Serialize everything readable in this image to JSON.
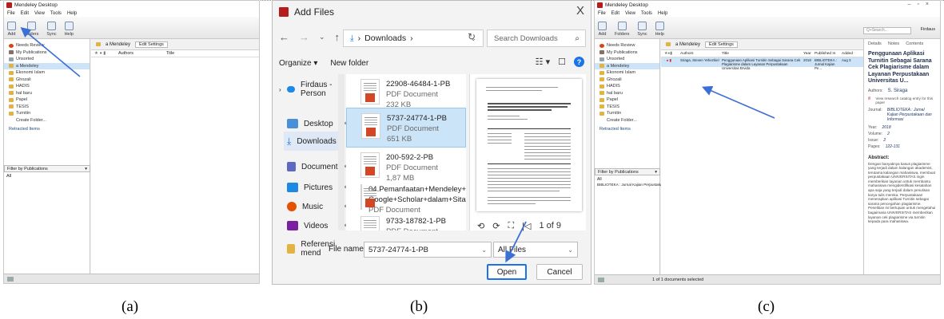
{
  "captions": [
    "(a)",
    "(b)",
    "(c)"
  ],
  "mendeley_a": {
    "title": "Mendeley Desktop",
    "menu": [
      "File",
      "Edit",
      "View",
      "Tools",
      "Help"
    ],
    "toolbar": [
      "Add",
      "Folders",
      "Sync",
      "Help"
    ],
    "sidebar": [
      "Needs Review",
      "My Publications",
      "Unsorted",
      "a Mendeley",
      "Ekonomi Islam",
      "Ghozali",
      "HADIS",
      "hal baru",
      "Papel",
      "TESIS",
      "Turnitin",
      "Create Folder..."
    ],
    "sidebar_section": "Retracted Items",
    "filter": "Filter by Publications",
    "filter_value": "All",
    "tab_title": "a Mendeley",
    "tab_edit": "Edit Settings",
    "columns": [
      "Authors",
      "Title"
    ]
  },
  "dialog": {
    "title": "Add Files",
    "close": "X",
    "path_label": "Downloads",
    "search_placeholder": "Search Downloads",
    "organize": "Organize",
    "new_folder": "New folder",
    "nav": [
      {
        "label": "Firdaus - Person",
        "color": "#1e88e5"
      },
      {
        "label": "Desktop",
        "color": "#4a90d9"
      },
      {
        "label": "Downloads",
        "color": "#2e7d32"
      },
      {
        "label": "Documents",
        "color": "#5c6bc0"
      },
      {
        "label": "Pictures",
        "color": "#1e88e5"
      },
      {
        "label": "Music",
        "color": "#e65100"
      },
      {
        "label": "Videos",
        "color": "#7b1fa2"
      },
      {
        "label": "Referensi mend",
        "color": "#e3b341"
      }
    ],
    "files": [
      {
        "name": "22908-46484-1-PB",
        "type": "PDF Document",
        "size": "232 KB"
      },
      {
        "name": "5737-24774-1-PB",
        "type": "PDF Document",
        "size": "651 KB"
      },
      {
        "name": "200-592-2-PB",
        "type": "PDF Document",
        "size": "1,87 MB"
      },
      {
        "name": "04.Pemanfaatan+Mendeley+dan+",
        "name2": "Google+Scholar+dalam+Sitasi",
        "type": "PDF Document"
      },
      {
        "name": "9733-18782-1-PB",
        "type": "PDF Document",
        "size": ""
      }
    ],
    "page_indicator": "1 of 9",
    "filename_label": "File name:",
    "filename_value": "5737-24774-1-PB",
    "filetype": "All Files",
    "open": "Open",
    "cancel": "Cancel"
  },
  "mendeley_c": {
    "title": "Mendeley Desktop",
    "menu": [
      "File",
      "Edit",
      "View",
      "Tools",
      "Help"
    ],
    "toolbar": [
      "Add",
      "Folders",
      "Sync",
      "Help"
    ],
    "user": "Firdaus",
    "search": "Q+Search...",
    "sidebar": [
      "Needs Review",
      "My Publications",
      "Unsorted",
      "a Mendeley",
      "Ekonomi Islam",
      "Ghozali",
      "HADIS",
      "hal baru",
      "Papel",
      "TESIS",
      "Turnitin",
      "Create Folder..."
    ],
    "sidebar_section": "Retracted Items",
    "filter": "Filter by Publications",
    "filter_value": "All",
    "filter_item": "BIBLIOTEKA : Jurnal Kajian Perpustakaan dan Inf",
    "tab_title": "a Mendeley",
    "tab_edit": "Edit Settings",
    "columns": [
      "Authors",
      "Title",
      "Year",
      "Published In",
      "Added"
    ],
    "row": {
      "author": "Siraga, Steven Yehezkiel",
      "title": "Penggunaan Aplikasi Turnitin Sebagai Sarana Cek Plagiarisme dalam Layanan Perpustakaan Universitas Brvida",
      "year": "2018",
      "published": "BIBLIOTEKA : Jurnal Kajian Pe...",
      "added": "Aug 3"
    },
    "detail_tabs": [
      "Details",
      "Notes",
      "Contents"
    ],
    "detail_title": "Penggunaan Aplikasi Turnitin Sebagai Sarana Cek Plagiarisme dalam Layanan Perpustakaan Universitas U...",
    "detail_authors_label": "Authors:",
    "detail_authors": "S. Siraga",
    "detail_catalog": "View research catalog entry for this paper",
    "detail_journal_label": "Journal:",
    "detail_journal": "BIBLIOTEKA : Jurnal Kajian Perpustakaan dan Informasi",
    "detail_year_label": "Year:",
    "detail_year": "2018",
    "detail_volume_label": "Volume:",
    "detail_volume": "2",
    "detail_issue_label": "Issue:",
    "detail_issue": "2",
    "detail_pages_label": "Pages:",
    "detail_pages": "122-131",
    "abstract_heading": "Abstract:",
    "abstract_text": "Dengan banyaknya kasus plagiarisme yang terjadi dalam kalangan akademisi, terutama kalangan mahasiswa, membuat perpustakaan UNIVERSITAS ingin memberikan layanan untuk membantu mahasiswa mengidentifikasi kesalahan apa saja yang terjadi dalam penulisan karya tulis mereka. Perpustakaan menerapkan aplikasi Turnitin sebagai sarana pencegahan plagiarisme. Penelitian ini bertujuan untuk mengetahui bagaimana UNIVERSITAS memberikan layanan cek plagiarisme via turnitin kepada para mahasiswa.",
    "status": "1 of 1 documents selected"
  },
  "colors": {
    "accent": "#1a73e8",
    "selection": "#cde3f7",
    "arrow": "#3b6fd4",
    "mendeley_red": "#b71c1c"
  }
}
